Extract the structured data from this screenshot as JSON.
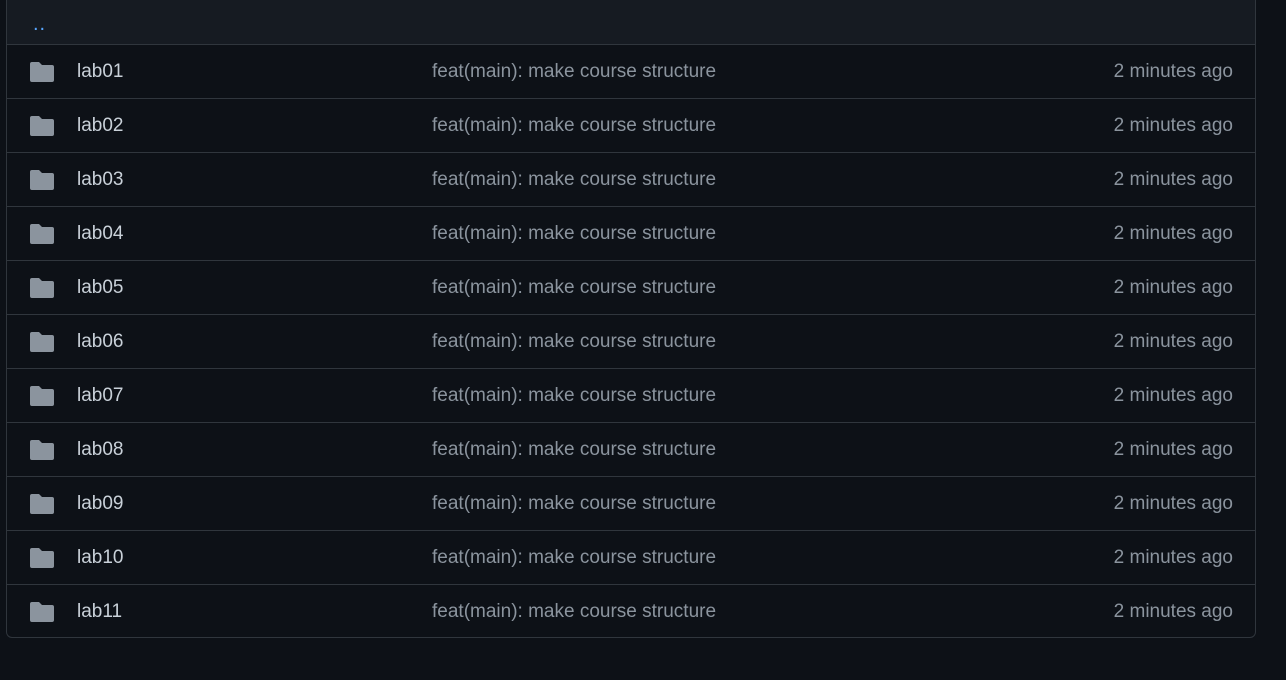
{
  "parent_link": "..",
  "rows": [
    {
      "name": "lab01",
      "icon": "folder-icon",
      "message": "feat(main): make course structure",
      "age": "2 minutes ago"
    },
    {
      "name": "lab02",
      "icon": "folder-icon",
      "message": "feat(main): make course structure",
      "age": "2 minutes ago"
    },
    {
      "name": "lab03",
      "icon": "folder-icon",
      "message": "feat(main): make course structure",
      "age": "2 minutes ago"
    },
    {
      "name": "lab04",
      "icon": "folder-icon",
      "message": "feat(main): make course structure",
      "age": "2 minutes ago"
    },
    {
      "name": "lab05",
      "icon": "folder-icon",
      "message": "feat(main): make course structure",
      "age": "2 minutes ago"
    },
    {
      "name": "lab06",
      "icon": "folder-icon",
      "message": "feat(main): make course structure",
      "age": "2 minutes ago"
    },
    {
      "name": "lab07",
      "icon": "folder-icon",
      "message": "feat(main): make course structure",
      "age": "2 minutes ago"
    },
    {
      "name": "lab08",
      "icon": "folder-icon",
      "message": "feat(main): make course structure",
      "age": "2 minutes ago"
    },
    {
      "name": "lab09",
      "icon": "folder-icon",
      "message": "feat(main): make course structure",
      "age": "2 minutes ago"
    },
    {
      "name": "lab10",
      "icon": "folder-icon",
      "message": "feat(main): make course structure",
      "age": "2 minutes ago"
    },
    {
      "name": "lab11",
      "icon": "folder-icon",
      "message": "feat(main): make course structure",
      "age": "2 minutes ago"
    }
  ],
  "colors": {
    "background": "#0d1117",
    "header_background": "#161b22",
    "border": "#30363d",
    "link": "#58a6ff",
    "folder_icon": "#8b949e",
    "primary_text": "#c9d1d9",
    "muted_text": "#8b949e"
  }
}
